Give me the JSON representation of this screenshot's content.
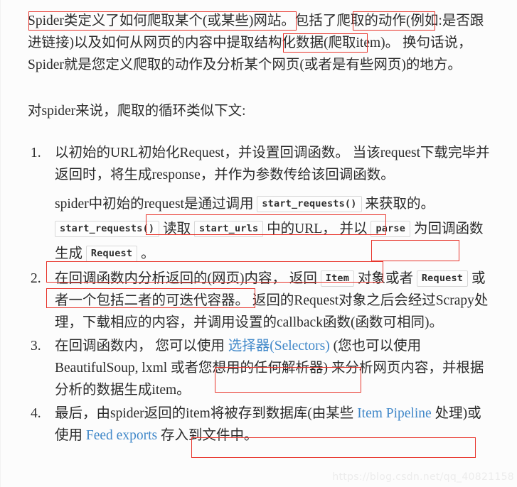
{
  "document": {
    "paragraphs": {
      "intro": {
        "seg1": "Spider类定义了如何爬取某个(或某些)网站。",
        "seg2": "包括了",
        "seg3": "爬取的动作",
        "seg4": "(例如:是否跟进链接)以及如何从网页的内容中",
        "seg5": "提取结构化数据",
        "seg6": "(爬取item)。 换句话说，Spider就是您定义爬取的动作及分析某个网页(或者是有些网页)的地方。"
      },
      "lead_in": "对spider来说，爬取的循环类似下文:"
    },
    "steps": [
      {
        "number": "1.",
        "text": "以初始的URL初始化Request，并设置回调函数。 当该request下载完毕并返回时，将生成response，并作为参数传给该回调函数。",
        "sub": {
          "a1": "spider中初始的",
          "a2": "request是通过调用",
          "code1": "start_requests()",
          "a3": "来获取的。",
          "code2": "start_requests()",
          "a4": "读取",
          "code3": "start_urls",
          "a5": "中的URL， 并以",
          "code4": "parse",
          "a6": "为回调函数生成",
          "code5": "Request",
          "a7": "。"
        }
      },
      {
        "number": "2.",
        "text_a": "在回调函数内分析返回的(网页)内容，",
        "text_b": "返回",
        "code_item": "Item",
        "text_c": "对象或者",
        "code_request": "Request",
        "text_d": "或者一个包括二者的可迭代容器。 返回的Request对象之后会经过Scrapy处理，下载相应的内容，并调用设置的callback函数(函数可相同)。"
      },
      {
        "number": "3.",
        "text_a": "在回调函数内， 您可以使用",
        "link": "选择器(Selectors)",
        "text_b": "(您也可以使用 BeautifulSoup, lxml 或者您想用的任何解析器) 来分析网页内容，并根据分析的数据生成item。"
      },
      {
        "number": "4.",
        "text_a": "最后，由spider返回的",
        "text_b": "item将被存到数据库(由某些",
        "link1": "Item Pipeline",
        "text_c": "处理)或使用",
        "link2": "Feed exports",
        "text_d": "存入到文件中。"
      }
    ],
    "watermark": "https://blog.csdn.net/qq_40821158",
    "colors": {
      "annotation_red": "#e8352c",
      "link_blue": "#4188c9",
      "text": "#2b2b2b",
      "background": "#fcfcfc",
      "code_border": "#d8d8d8",
      "watermark": "#ececec"
    }
  }
}
